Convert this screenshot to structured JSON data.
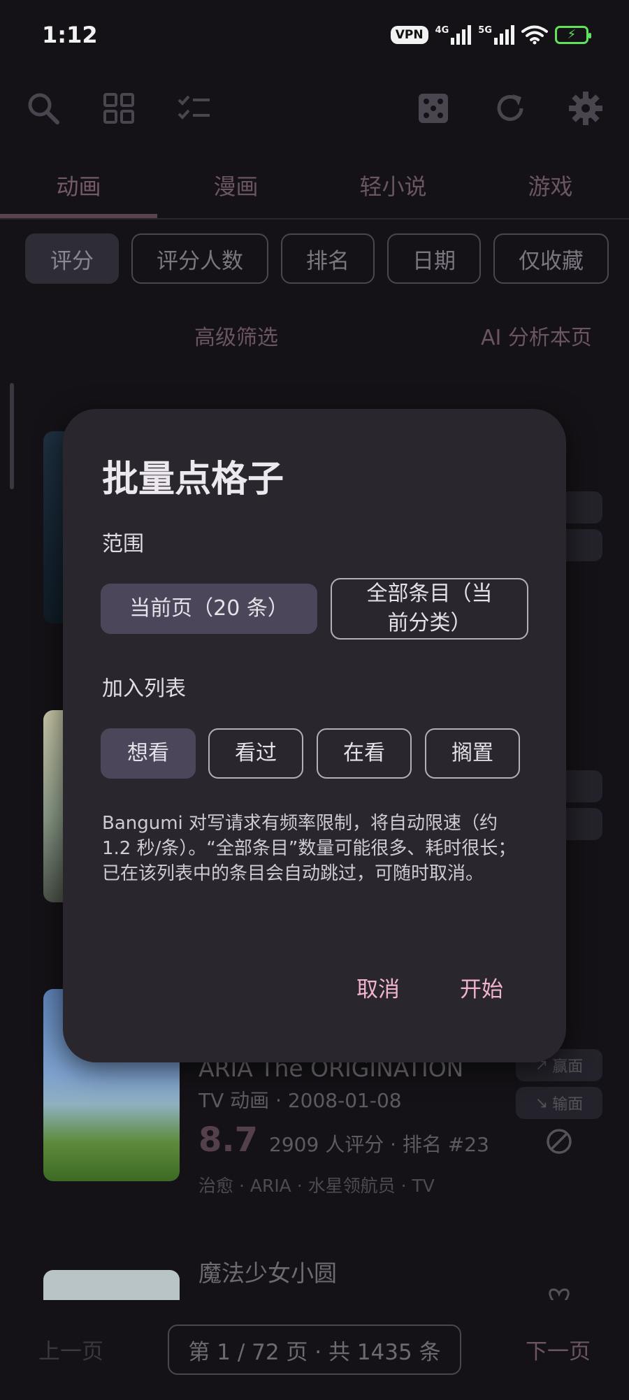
{
  "status_bar": {
    "time": "1:12",
    "vpn": "VPN",
    "net1": "4G",
    "net2": "5G",
    "battery_color": "#5ee35a"
  },
  "toolbar": {
    "icons": [
      "search-icon",
      "grid-icon",
      "checklist-icon",
      "dice-icon",
      "refresh-icon",
      "settings-icon"
    ]
  },
  "tabs": [
    "动画",
    "漫画",
    "轻小说",
    "游戏"
  ],
  "sort_chips": [
    "评分",
    "评分人数",
    "排名",
    "日期",
    "仅收藏"
  ],
  "filters": {
    "advanced": "高级筛选",
    "ai": "AI 分析本页"
  },
  "cards": {
    "third": {
      "title_partial": "ARIA The ORIGINATION",
      "meta": "TV 动画 · 2008-01-08",
      "score": "8.7",
      "score_meta": "2909 人评分 · 排名 #23",
      "tags": "治愈 · ARIA · 水星领航员 · TV",
      "win_label": "赢面",
      "lose_label": "输面"
    },
    "fourth": {
      "title": "魔法少女小圆"
    }
  },
  "pager": {
    "prev": "上一页",
    "info": "第 1 / 72 页 · 共 1435 条",
    "next": "下一页"
  },
  "dialog": {
    "title": "批量点格子",
    "scope_label": "范围",
    "scope_current": "当前页（20 条）",
    "scope_all_line1": "全部条目（当",
    "scope_all_line2": "前分类）",
    "list_label": "加入列表",
    "list_options": [
      "想看",
      "看过",
      "在看",
      "搁置"
    ],
    "note": "Bangumi 对写请求有频率限制，将自动限速（约 1.2 秒/条）。“全部条目”数量可能很多、耗时很长；已在该列表中的条目会自动跳过，可随时取消。",
    "cancel": "取消",
    "start": "开始"
  }
}
